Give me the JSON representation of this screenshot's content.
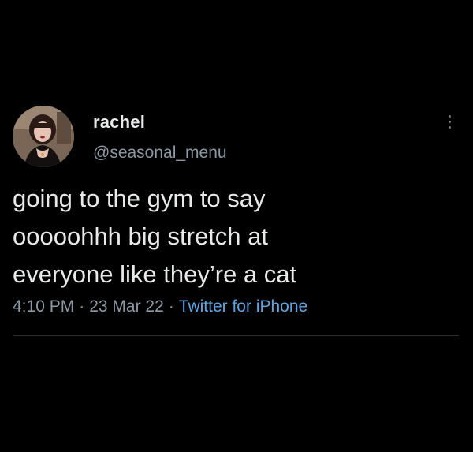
{
  "author": {
    "display_name": "rachel",
    "handle": "@seasonal_menu"
  },
  "tweet": {
    "lines": [
      "going to the gym to say",
      "ooooohhh big stretch at",
      "everyone like they’re a cat"
    ]
  },
  "meta": {
    "time": "4:10 PM",
    "separator": "·",
    "date": "23 Mar 22",
    "source": "Twitter for iPhone"
  },
  "icons": {
    "more": "more-vertical-icon"
  },
  "colors": {
    "background": "#000000",
    "text_primary": "#e7e9ea",
    "text_secondary": "#8b98a5",
    "link": "#5aa5e8"
  }
}
